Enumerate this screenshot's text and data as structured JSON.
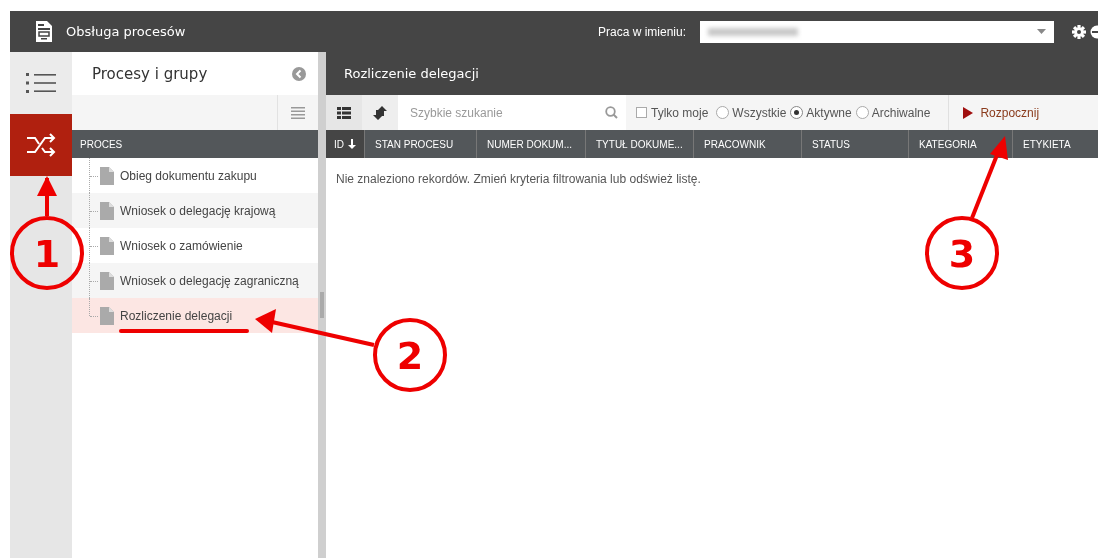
{
  "top_bar": {
    "title": "Obsługa procesów",
    "on_behalf_label": "Praca w imieniu:",
    "on_behalf_blurred": true
  },
  "rail": {
    "items": [
      {
        "kind": "list",
        "selected": false
      },
      {
        "kind": "shuffle",
        "selected": true
      }
    ]
  },
  "left_panel": {
    "title": "Procesy i grupy",
    "column": "PROCES",
    "items": [
      {
        "label": "Obieg dokumentu zakupu",
        "selected": false
      },
      {
        "label": "Wniosek o delegację krajową",
        "selected": false
      },
      {
        "label": "Wniosek o zamówienie",
        "selected": false
      },
      {
        "label": "Wniosek o delegację zagraniczną",
        "selected": false
      },
      {
        "label": "Rozliczenie delegacji",
        "selected": true
      }
    ]
  },
  "main": {
    "title": "Rozliczenie delegacji",
    "search": {
      "placeholder": "Szybkie szukanie"
    },
    "only_mine": {
      "label": "Tylko moje",
      "checked": false
    },
    "filters": [
      {
        "label": "Wszystkie",
        "selected": false
      },
      {
        "label": "Aktywne",
        "selected": true
      },
      {
        "label": "Archiwalne",
        "selected": false
      }
    ],
    "start_button": "Rozpocznij",
    "columns": [
      "ID",
      "STAN PROCESU",
      "NUMER DOKUM...",
      "TYTUŁ DOKUME...",
      "PRACOWNIK",
      "STATUS",
      "KATEGORIA",
      "ETYKIETA"
    ],
    "empty_message": "Nie znaleziono rekordów. Zmień kryteria filtrowania lub odśwież listę."
  },
  "annotations": [
    {
      "label": "1"
    },
    {
      "label": "2"
    },
    {
      "label": "3"
    }
  ]
}
